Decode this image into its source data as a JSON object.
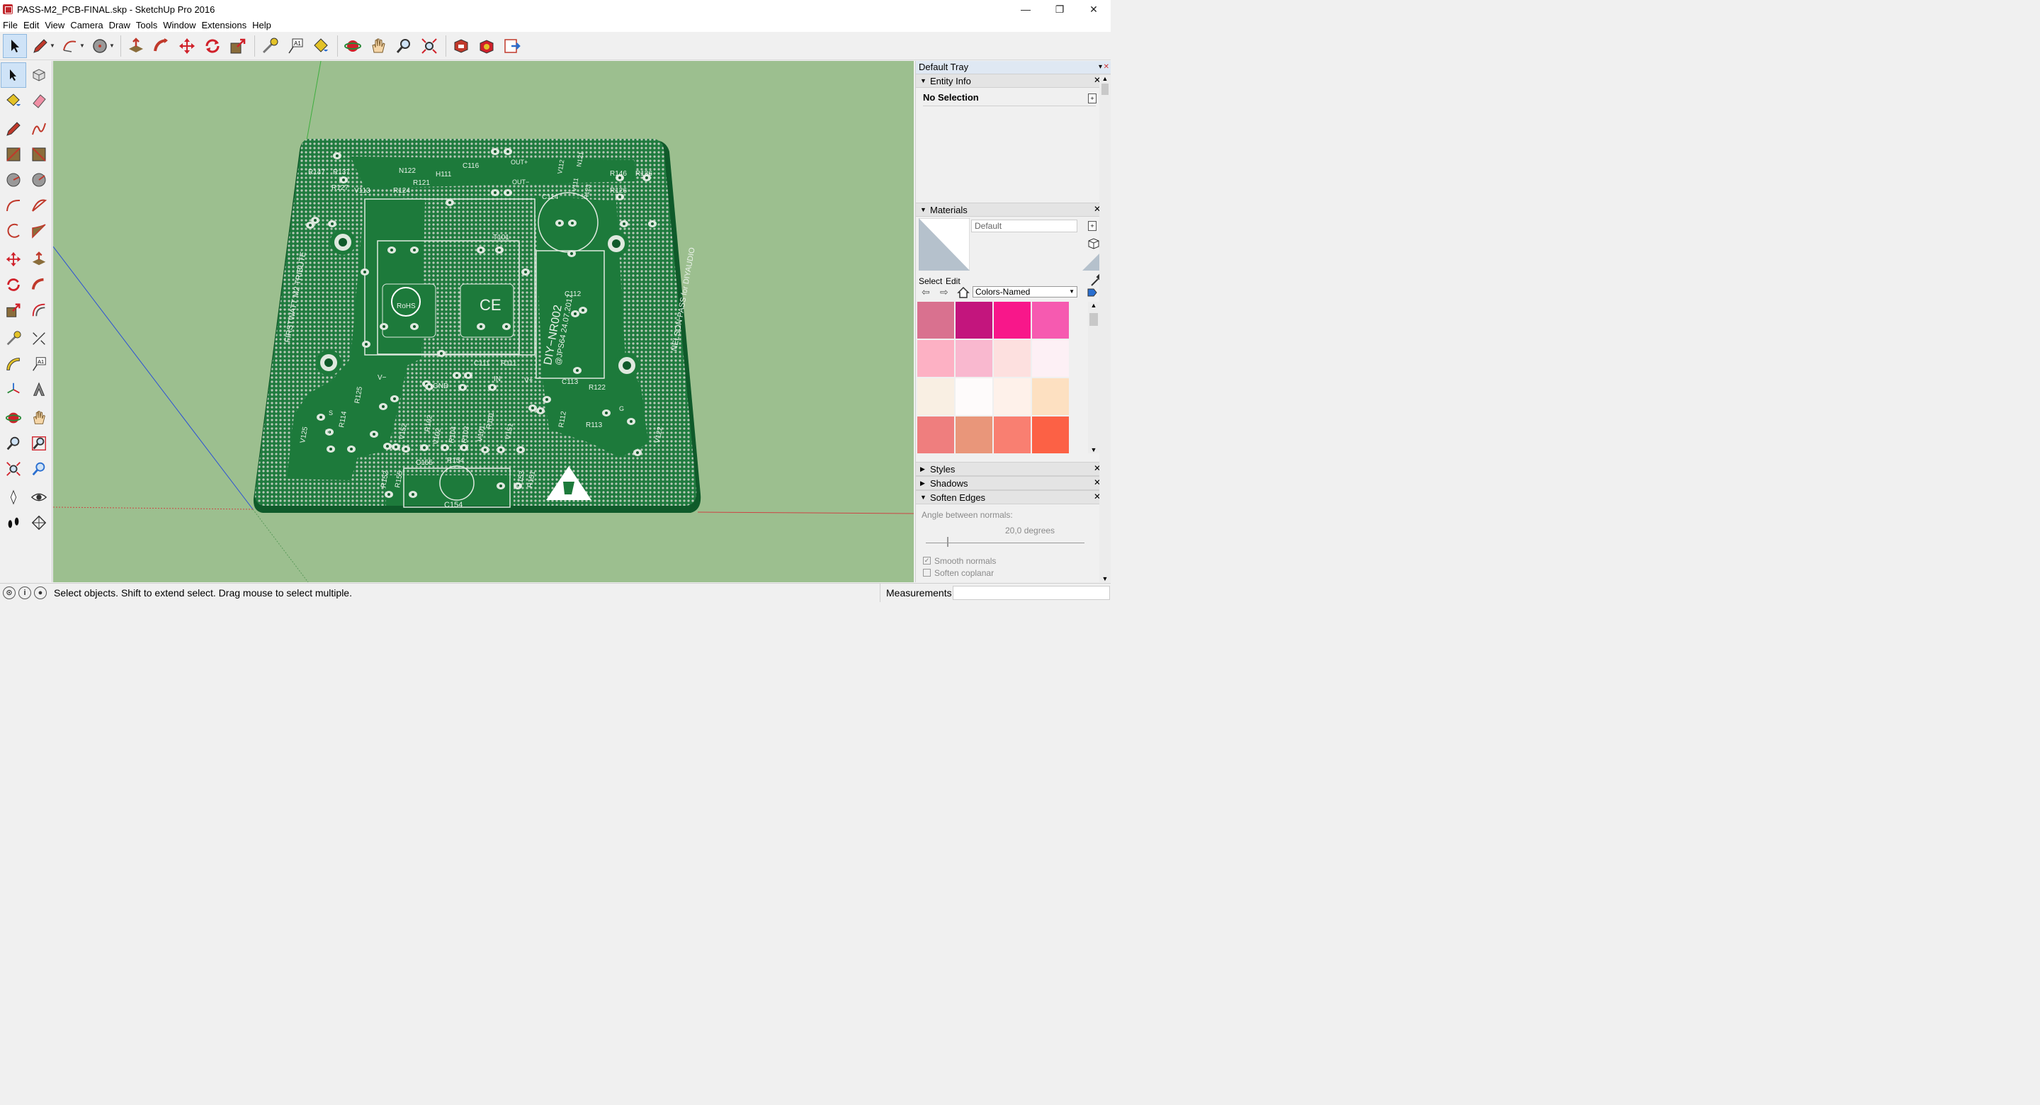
{
  "window": {
    "title": "PASS-M2_PCB-FINAL.skp - SketchUp Pro 2016",
    "controls": [
      "—",
      "❐",
      "✕"
    ]
  },
  "menu": [
    "File",
    "Edit",
    "View",
    "Camera",
    "Draw",
    "Tools",
    "Window",
    "Extensions",
    "Help"
  ],
  "toolbar_icons": [
    "select-icon",
    "pencil-icon",
    "arc-icon",
    "circle-icon",
    "push-pull-icon",
    "follow-me-icon",
    "move-icon",
    "rotate-icon",
    "scale-icon",
    "tape-measure-icon",
    "text-icon",
    "paint-bucket-icon",
    "orbit-icon",
    "pan-icon",
    "zoom-icon",
    "zoom-extents-icon",
    "warehouse-icon",
    "extension-warehouse-icon",
    "send-to-layout-icon"
  ],
  "tray": {
    "title": "Default Tray",
    "entity_info": {
      "label": "Entity Info",
      "selection": "No Selection"
    },
    "materials": {
      "label": "Materials",
      "name": "Default",
      "tab_select": "Select",
      "tab_edit": "Edit",
      "library": "Colors-Named",
      "swatches": [
        "#d9718f",
        "#c3157d",
        "#f8178a",
        "#f65ab0",
        "#fdb1c4",
        "#f9b8cf",
        "#fde0df",
        "#fdf0f5",
        "#f9efe3",
        "#fefbfb",
        "#fef1ea",
        "#fde0c1",
        "#ef7e7e",
        "#e9967a",
        "#f97f71",
        "#fc6145"
      ]
    },
    "styles": {
      "label": "Styles"
    },
    "shadows": {
      "label": "Shadows"
    },
    "soften": {
      "label": "Soften Edges",
      "angle_label": "Angle between normals:",
      "angle_value": "20,0  degrees",
      "smooth_label": "Smooth normals",
      "coplanar_label": "Soften coplanar"
    }
  },
  "status": {
    "text": "Select objects. Shift to extend select. Drag mouse to select multiple.",
    "measurements_label": "Measurements"
  },
  "pcb": {
    "labels": [
      "R147",
      "R137",
      "R127",
      "V113",
      "R124",
      "N122",
      "R121",
      "H111",
      "C116",
      "OUT+",
      "OUT−",
      "V112",
      "N121",
      "R123",
      "V111",
      "R146",
      "R136",
      "R126",
      "C114",
      "T101",
      "RoHS",
      "CE",
      "C112",
      "DIY−NR002",
      "@JPS64  24.07.2017",
      "FIRSTWATT M2 TRIBUTE",
      "NELSON PASS for DIYAUDIO",
      "C111",
      "R111",
      "IN",
      "GND",
      "V−",
      "V+",
      "C113",
      "R122",
      "R112",
      "R113",
      "R114",
      "R125",
      "V125",
      "V152",
      "R102",
      "V102",
      "R104",
      "R103",
      "V101",
      "R101",
      "V151",
      "V122",
      "C155",
      "R154",
      "R152",
      "R155",
      "R153",
      "R151",
      "C154",
      "S",
      "D",
      "G"
    ]
  }
}
